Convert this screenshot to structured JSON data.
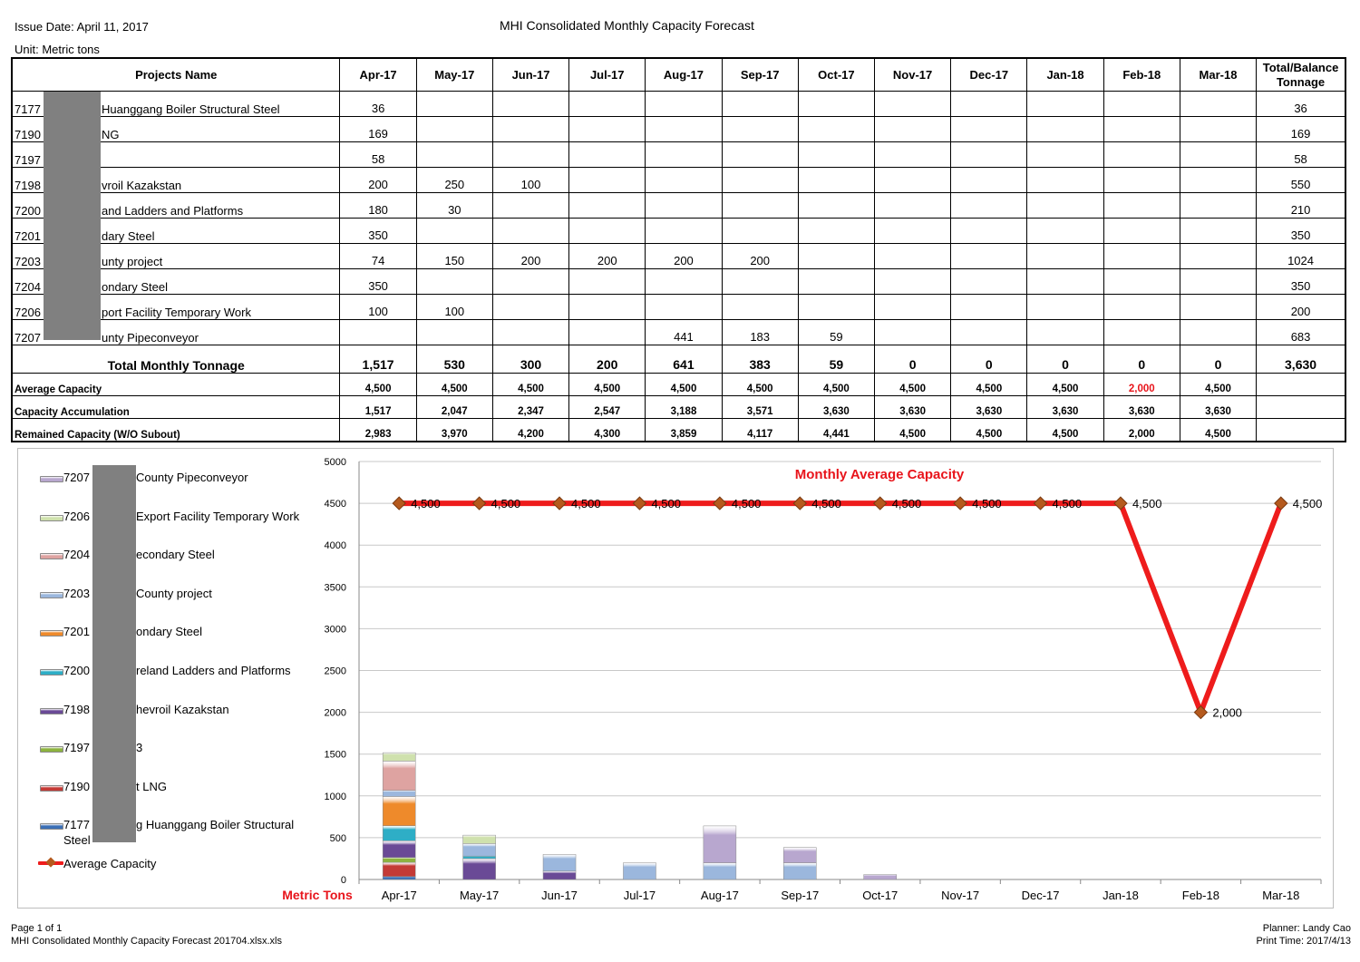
{
  "header": {
    "issue_date": "Issue Date: April 11, 2017",
    "title": "MHI Consolidated Monthly Capacity Forecast",
    "unit": "Unit: Metric tons"
  },
  "table": {
    "name_header": "Projects Name",
    "months": [
      "Apr-17",
      "May-17",
      "Jun-17",
      "Jul-17",
      "Aug-17",
      "Sep-17",
      "Oct-17",
      "Nov-17",
      "Dec-17",
      "Jan-18",
      "Feb-18",
      "Mar-18"
    ],
    "total_header": "Total/Balance Tonnage",
    "projects": [
      {
        "id": "7177",
        "name": "Huanggang Boiler Structural Steel",
        "values": [
          "36",
          "",
          "",
          "",
          "",
          "",
          "",
          "",
          "",
          "",
          "",
          ""
        ],
        "total": "36"
      },
      {
        "id": "7190",
        "name": "NG",
        "values": [
          "169",
          "",
          "",
          "",
          "",
          "",
          "",
          "",
          "",
          "",
          "",
          ""
        ],
        "total": "169"
      },
      {
        "id": "7197",
        "name": "",
        "values": [
          "58",
          "",
          "",
          "",
          "",
          "",
          "",
          "",
          "",
          "",
          "",
          ""
        ],
        "total": "58"
      },
      {
        "id": "7198",
        "name": "vroil Kazakstan",
        "values": [
          "200",
          "250",
          "100",
          "",
          "",
          "",
          "",
          "",
          "",
          "",
          "",
          ""
        ],
        "total": "550"
      },
      {
        "id": "7200",
        "name": "and Ladders and Platforms",
        "values": [
          "180",
          "30",
          "",
          "",
          "",
          "",
          "",
          "",
          "",
          "",
          "",
          ""
        ],
        "total": "210"
      },
      {
        "id": "7201",
        "name": "dary Steel",
        "values": [
          "350",
          "",
          "",
          "",
          "",
          "",
          "",
          "",
          "",
          "",
          "",
          ""
        ],
        "total": "350"
      },
      {
        "id": "7203",
        "name": "unty project",
        "values": [
          "74",
          "150",
          "200",
          "200",
          "200",
          "200",
          "",
          "",
          "",
          "",
          "",
          ""
        ],
        "total": "1024"
      },
      {
        "id": "7204",
        "name": "ondary Steel",
        "values": [
          "350",
          "",
          "",
          "",
          "",
          "",
          "",
          "",
          "",
          "",
          "",
          ""
        ],
        "total": "350"
      },
      {
        "id": "7206",
        "name": "port Facility Temporary Work",
        "values": [
          "100",
          "100",
          "",
          "",
          "",
          "",
          "",
          "",
          "",
          "",
          "",
          ""
        ],
        "total": "200"
      },
      {
        "id": "7207",
        "name": "unty Pipeconveyor",
        "values": [
          "",
          "",
          "",
          "",
          "441",
          "183",
          "59",
          "",
          "",
          "",
          "",
          ""
        ],
        "total": "683"
      }
    ],
    "total_row": {
      "label": "Total Monthly Tonnage",
      "values": [
        "1,517",
        "530",
        "300",
        "200",
        "641",
        "383",
        "59",
        "0",
        "0",
        "0",
        "0",
        "0"
      ],
      "total": "3,630"
    },
    "avg_row": {
      "label": "Average Capacity",
      "values": [
        "4,500",
        "4,500",
        "4,500",
        "4,500",
        "4,500",
        "4,500",
        "4,500",
        "4,500",
        "4,500",
        "4,500",
        "2,000",
        "4,500"
      ],
      "highlight_color": "#e8141b"
    },
    "accum_row": {
      "label": "Capacity Accumulation",
      "values": [
        "1,517",
        "2,047",
        "2,347",
        "2,547",
        "3,188",
        "3,571",
        "3,630",
        "3,630",
        "3,630",
        "3,630",
        "3,630",
        "3,630"
      ]
    },
    "remain_row": {
      "label": "Remained Capacity (W/O Subout)",
      "values": [
        "2,983",
        "3,970",
        "4,200",
        "4,300",
        "3,859",
        "4,117",
        "4,441",
        "4,500",
        "4,500",
        "4,500",
        "2,000",
        "4,500"
      ]
    }
  },
  "chart_data": {
    "type": "bar",
    "title": "Monthly Average Capacity",
    "ylabel": "",
    "xlabel": "Metric Tons",
    "categories": [
      "Apr-17",
      "May-17",
      "Jun-17",
      "Jul-17",
      "Aug-17",
      "Sep-17",
      "Oct-17",
      "Nov-17",
      "Dec-17",
      "Jan-18",
      "Feb-18",
      "Mar-18"
    ],
    "ylim": [
      0,
      5000
    ],
    "yticks": [
      0,
      500,
      1000,
      1500,
      2000,
      2500,
      3000,
      3500,
      4000,
      4500,
      5000
    ],
    "grid": true,
    "legend_position": "left",
    "stack_order": [
      "7177",
      "7190",
      "7197",
      "7198",
      "7200",
      "7201",
      "7203",
      "7204",
      "7206",
      "7207"
    ],
    "series": [
      {
        "name": "7177",
        "legend": "g Huanggang Boiler Structural Steel",
        "color": "#3b6fb6",
        "values": [
          36,
          0,
          0,
          0,
          0,
          0,
          0,
          0,
          0,
          0,
          0,
          0
        ]
      },
      {
        "name": "7190",
        "legend": "t LNG",
        "color": "#c43a36",
        "values": [
          169,
          0,
          0,
          0,
          0,
          0,
          0,
          0,
          0,
          0,
          0,
          0
        ]
      },
      {
        "name": "7197",
        "legend": "3",
        "color": "#8db33f",
        "values": [
          58,
          0,
          0,
          0,
          0,
          0,
          0,
          0,
          0,
          0,
          0,
          0
        ]
      },
      {
        "name": "7198",
        "legend": "hevroil Kazakstan",
        "color": "#6a4a96",
        "values": [
          200,
          250,
          100,
          0,
          0,
          0,
          0,
          0,
          0,
          0,
          0,
          0
        ]
      },
      {
        "name": "7200",
        "legend": "reland Ladders and Platforms",
        "color": "#2eaec6",
        "values": [
          180,
          30,
          0,
          0,
          0,
          0,
          0,
          0,
          0,
          0,
          0,
          0
        ]
      },
      {
        "name": "7201",
        "legend": "ondary Steel",
        "color": "#ee8a2b",
        "values": [
          350,
          0,
          0,
          0,
          0,
          0,
          0,
          0,
          0,
          0,
          0,
          0
        ]
      },
      {
        "name": "7203",
        "legend": "County project",
        "color": "#9bb7dd",
        "values": [
          74,
          150,
          200,
          200,
          200,
          200,
          0,
          0,
          0,
          0,
          0,
          0
        ]
      },
      {
        "name": "7204",
        "legend": "econdary Steel",
        "color": "#dea3a1",
        "values": [
          350,
          0,
          0,
          0,
          0,
          0,
          0,
          0,
          0,
          0,
          0,
          0
        ]
      },
      {
        "name": "7206",
        "legend": "Export Facility Temporary Work",
        "color": "#cfe1ad",
        "values": [
          100,
          100,
          0,
          0,
          0,
          0,
          0,
          0,
          0,
          0,
          0,
          0
        ]
      },
      {
        "name": "7207",
        "legend": "County Pipeconveyor",
        "color": "#b8a7cf",
        "values": [
          0,
          0,
          0,
          0,
          441,
          183,
          59,
          0,
          0,
          0,
          0,
          0
        ]
      }
    ],
    "line_series": {
      "name": "Average Capacity",
      "color": "#ee1c1c",
      "marker_color": "#b55a1e",
      "values": [
        4500,
        4500,
        4500,
        4500,
        4500,
        4500,
        4500,
        4500,
        4500,
        4500,
        2000,
        4500
      ],
      "labels": [
        "4,500",
        "4,500",
        "4,500",
        "4,500",
        "4,500",
        "4,500",
        "4,500",
        "4,500",
        "4,500",
        "4,500",
        "2,000",
        "4,500"
      ]
    },
    "title_color": "#e8141b"
  },
  "footer": {
    "page": "Page 1 of 1",
    "file": "MHI Consolidated Monthly Capacity Forecast 201704.xlsx.xls",
    "planner": "Planner: Landy Cao",
    "print_time": "Print Time: 2017/4/13"
  }
}
